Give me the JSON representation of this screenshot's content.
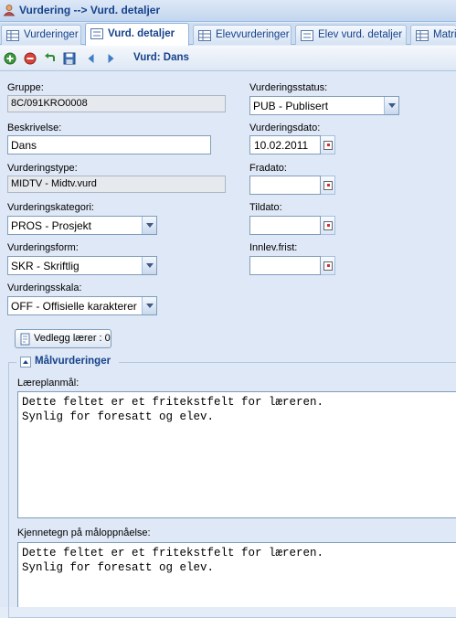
{
  "window": {
    "title": "Vurdering --> Vurd. detaljer",
    "icon": "user-icon"
  },
  "tabs": [
    {
      "label": "Vurderinger",
      "icon": "grid-icon"
    },
    {
      "label": "Vurd. detaljer",
      "icon": "form-icon",
      "active": true
    },
    {
      "label": "Elevvurderinger",
      "icon": "grid-icon"
    },
    {
      "label": "Elev vurd. detaljer",
      "icon": "form-icon"
    },
    {
      "label": "Matri",
      "icon": "grid-icon"
    }
  ],
  "toolbar": {
    "buttons": [
      "add-icon",
      "delete-icon",
      "undo-icon",
      "save-icon",
      "previous-icon",
      "next-icon"
    ],
    "title": "Vurd: Dans"
  },
  "form": {
    "gruppe": {
      "label": "Gruppe:",
      "value": "8C/091KRO0008"
    },
    "beskrivelse": {
      "label": "Beskrivelse:",
      "value": "Dans"
    },
    "vurderingstype": {
      "label": "Vurderingstype:",
      "value": "MIDTV - Midtv.vurd"
    },
    "vurderingskategori": {
      "label": "Vurderingskategori:",
      "value": "PROS - Prosjekt"
    },
    "vurderingsform": {
      "label": "Vurderingsform:",
      "value": "SKR - Skriftlig"
    },
    "vurderingsskala": {
      "label": "Vurderingsskala:",
      "value": "OFF - Offisielle karakterer"
    },
    "vurderingsstatus": {
      "label": "Vurderingsstatus:",
      "value": "PUB - Publisert"
    },
    "vurderingsdato": {
      "label": "Vurderingsdato:",
      "value": "10.02.2011"
    },
    "fradato": {
      "label": "Fradato:",
      "value": ""
    },
    "tildato": {
      "label": "Tildato:",
      "value": ""
    },
    "innlevfrist": {
      "label": "Innlev.frist:",
      "value": ""
    }
  },
  "attachments_button": "Vedlegg lærer : 0",
  "malvurderinger": {
    "legend": "Målvurderinger",
    "laereplanmal": {
      "label": "Læreplanmål:",
      "value": "Dette feltet er et fritekstfelt for læreren.\nSynlig for foresatt og elev."
    },
    "kjennetegn": {
      "label": "Kjennetegn på måloppnåelse:",
      "value": "Dette feltet er et fritekstfelt for læreren.\nSynlig for foresatt og elev."
    }
  },
  "colors": {
    "header_text": "#15428b",
    "panel_bg": "#dfe8f6",
    "border": "#7f9db9"
  }
}
